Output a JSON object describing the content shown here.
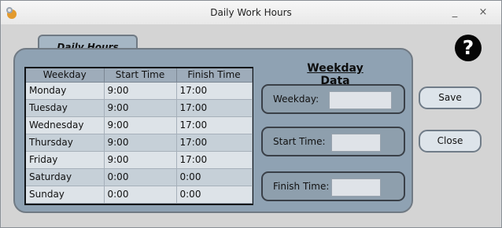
{
  "window": {
    "title": "Daily Work Hours",
    "minimize_label": "_",
    "close_label": "×"
  },
  "help": {
    "label": "?"
  },
  "panel": {
    "tab_label": "Daily Hours",
    "table": {
      "headers": [
        "Weekday",
        "Start Time",
        "Finish Time"
      ],
      "rows": [
        [
          "Monday",
          "9:00",
          "17:00"
        ],
        [
          "Tuesday",
          "9:00",
          "17:00"
        ],
        [
          "Wednesday",
          "9:00",
          "17:00"
        ],
        [
          "Thursday",
          "9:00",
          "17:00"
        ],
        [
          "Friday",
          "9:00",
          "17:00"
        ],
        [
          "Saturday",
          "0:00",
          "0:00"
        ],
        [
          "Sunday",
          "0:00",
          "0:00"
        ]
      ]
    },
    "weekday_data": {
      "title": "Weekday Data",
      "weekday_label": "Weekday:",
      "start_label": "Start Time:",
      "finish_label": "Finish Time:",
      "weekday_value": "",
      "start_value": "",
      "finish_value": ""
    }
  },
  "buttons": {
    "save": "Save",
    "close": "Close"
  },
  "colors": {
    "panel": "#8fa2b3",
    "header": "#9eacba",
    "row_alt": "#c6d0d8",
    "row": "#dde3e8"
  }
}
